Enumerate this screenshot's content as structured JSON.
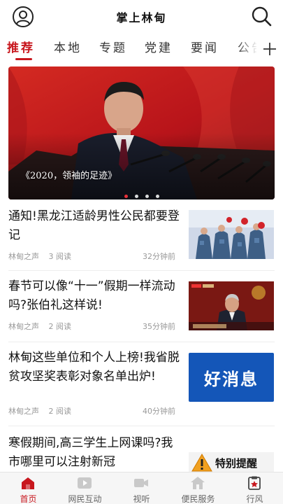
{
  "header": {
    "title": "掌上林甸",
    "avatar_icon": "user-circle-icon",
    "search_icon": "search-icon"
  },
  "tabs": [
    {
      "label": "推荐",
      "active": true
    },
    {
      "label": "本地",
      "active": false
    },
    {
      "label": "专题",
      "active": false
    },
    {
      "label": "党建",
      "active": false
    },
    {
      "label": "要闻",
      "active": false
    },
    {
      "label": "公告",
      "active": false
    }
  ],
  "tabs_more_icon": "plus-icon",
  "banner": {
    "caption": "《2020，领袖的足迹》",
    "dots": 4,
    "active_dot": 1
  },
  "news": [
    {
      "headline": "通知!黑龙江适龄男性公民都要登记",
      "source": "林甸之声",
      "reads": "3 阅读",
      "time": "32分钟前"
    },
    {
      "headline": "春节可以像“十一”假期一样流动吗?张伯礼这样说!",
      "source": "林甸之声",
      "reads": "2 阅读",
      "time": "35分钟前"
    },
    {
      "headline": "林甸这些单位和个人上榜!我省脱贫攻坚奖表彰对象名单出炉!",
      "source": "林甸之声",
      "reads": "2 阅读",
      "time": "40分钟前",
      "thumb_text": "好消息"
    },
    {
      "headline": "寒假期间,高三学生上网课吗?我市哪里可以注射新冠",
      "thumb_text": "特别提醒"
    }
  ],
  "bottom_nav": [
    {
      "label": "首页",
      "icon": "home-icon",
      "active": true
    },
    {
      "label": "网民互动",
      "icon": "play-icon",
      "active": false
    },
    {
      "label": "视听",
      "icon": "video-camera-icon",
      "active": false
    },
    {
      "label": "便民服务",
      "icon": "house-service-icon",
      "active": false
    },
    {
      "label": "行风",
      "icon": "clipboard-icon",
      "active": false
    }
  ],
  "colors": {
    "accent": "#c8171e",
    "text": "#111111",
    "meta": "#999999"
  }
}
